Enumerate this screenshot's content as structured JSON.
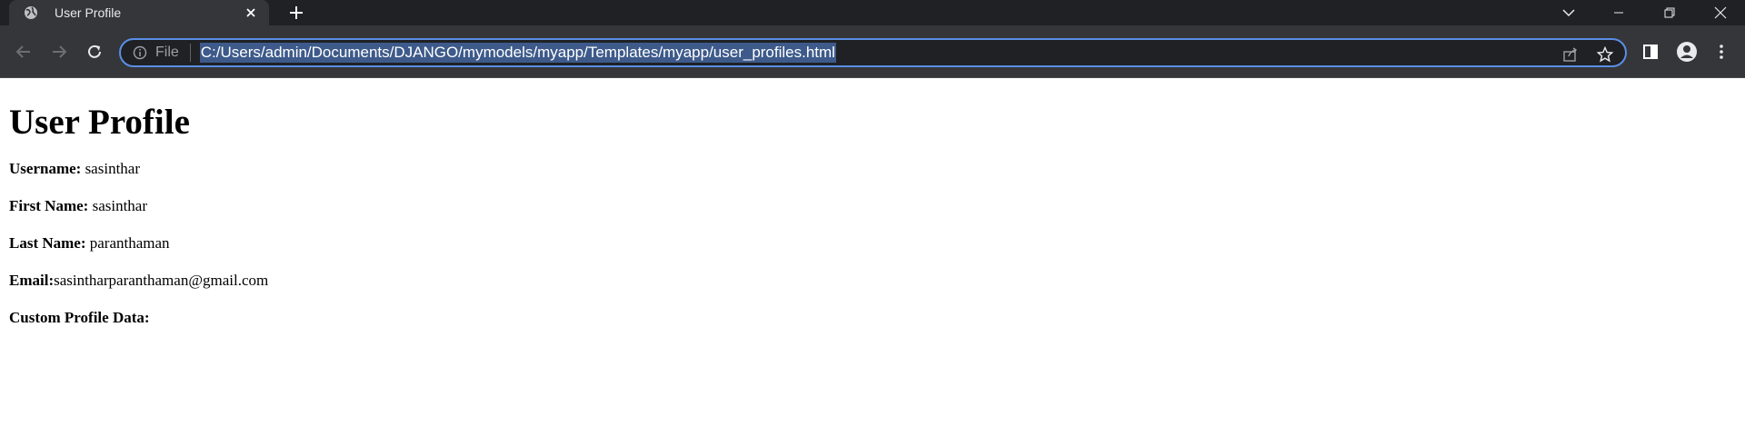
{
  "browser": {
    "tab": {
      "title": "User Profile",
      "favicon": "globe-icon"
    },
    "address_bar": {
      "scheme_label": "File",
      "url": "C:/Users/admin/Documents/DJANGO/mymodels/myapp/Templates/myapp/user_profiles.html"
    },
    "colors": {
      "tabstrip_bg": "#202124",
      "toolbar_bg": "#35363a",
      "omnibox_border": "#5a8fe6",
      "url_selection": "#3d5a8a"
    }
  },
  "page": {
    "heading": "User Profile",
    "fields": [
      {
        "label": "Username:",
        "value": " sasinthar"
      },
      {
        "label": "First Name:",
        "value": " sasinthar"
      },
      {
        "label": "Last Name:",
        "value": " paranthaman"
      },
      {
        "label": "Email:",
        "value": "sasintharparanthaman@gmail.com"
      },
      {
        "label": "Custom Profile Data:",
        "value": ""
      }
    ]
  }
}
